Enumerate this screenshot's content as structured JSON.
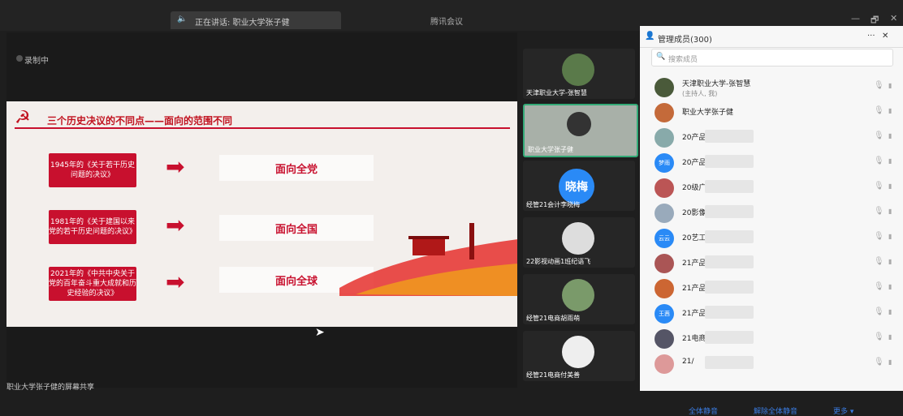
{
  "window": {
    "speaking_label": "正在讲话: 职业大学张子健",
    "app_title": "腾讯会议",
    "minimize": "—",
    "maximize": "🗗",
    "close": "✕"
  },
  "stage": {
    "recording_label": "录制中",
    "bottom_label": "职业大学张子健的屏幕共享"
  },
  "slide": {
    "title": "三个历史决议的不同点——面向的范围不同",
    "rows": [
      {
        "resolution": "1945年的《关于若干历史问题的决议》",
        "scope": "面向全党"
      },
      {
        "resolution": "1981年的《关于建国以来党的若干历史问题的决议》",
        "scope": "面向全国"
      },
      {
        "resolution": "2021年的《中共中央关于党的百年奋斗重大成就和历史经验的决议》",
        "scope": "面向全球"
      }
    ]
  },
  "video_tiles": [
    {
      "name": "天津职业大学-张智慧",
      "kind": "photo"
    },
    {
      "name": "职业大学张子健",
      "kind": "camera"
    },
    {
      "name": "经管21会计李晓梅",
      "kind": "initials",
      "initials": "晓梅"
    },
    {
      "name": "22影视动画1班纪语飞",
      "kind": "photo"
    },
    {
      "name": "经管21电商胡雨萌",
      "kind": "photo"
    },
    {
      "name": "经管21电商付美善",
      "kind": "photo"
    }
  ],
  "panel": {
    "header": "管理成员(300)",
    "search_placeholder": "搜索成员",
    "more": "···",
    "close": "✕",
    "members": [
      {
        "name": "天津职业大学-张智慧",
        "sub": "(主持人, 我)"
      },
      {
        "name": "职业大学张子健",
        "sub": ""
      },
      {
        "name": "20产品",
        "sub": ""
      },
      {
        "name": "20产品二",
        "sub": "",
        "avatar_text": "梦雨"
      },
      {
        "name": "20级广告1班",
        "sub": ""
      },
      {
        "name": "20影像1",
        "sub": ""
      },
      {
        "name": "20艺工",
        "sub": "",
        "avatar_text": "云云"
      },
      {
        "name": "21产品",
        "sub": ""
      },
      {
        "name": "21产品",
        "sub": ""
      },
      {
        "name": "21产品",
        "sub": "",
        "avatar_text": "王茜"
      },
      {
        "name": "21电商",
        "sub": ""
      },
      {
        "name": "21/",
        "sub": ""
      }
    ],
    "footer": {
      "mute_all": "全体静音",
      "unmute_all": "解除全体静音",
      "more": "更多 ▾"
    }
  },
  "colors": {
    "accent_red": "#c8102e",
    "link_blue": "#3a7be0",
    "initials_blue": "#2a8af6"
  }
}
